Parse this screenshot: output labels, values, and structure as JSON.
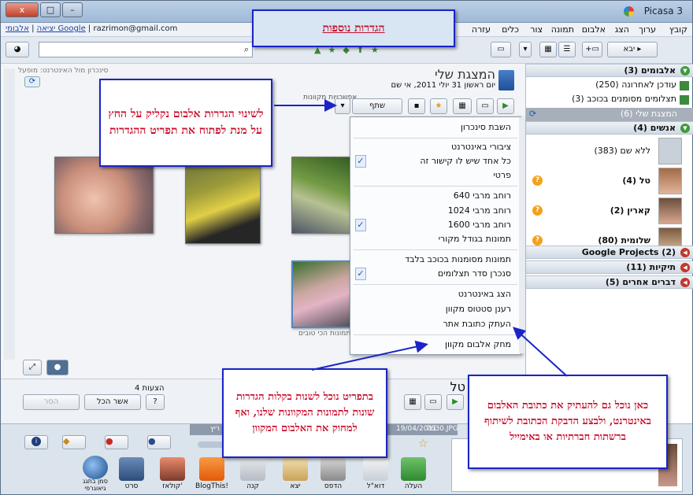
{
  "window": {
    "title": "Picasa 3"
  },
  "titlebar_buttons": {
    "close": "x",
    "max": "□",
    "min": "–"
  },
  "menu": [
    "קובץ",
    "ערוך",
    "הצג",
    "אלבום",
    "תמונה",
    "צור",
    "כלים",
    "עזרה"
  ],
  "account": {
    "signout": "יציאה",
    "google_albums": "אלבומי Google",
    "email": "razrimon@gmail.com"
  },
  "toolbar": {
    "import": "יבא"
  },
  "banner": {
    "title": "הגדרות נוספות"
  },
  "album": {
    "title": "המצגת שלי",
    "date": "יום ראשון 31 יולי 2011, אי שם",
    "share_button": "שתף",
    "sync_label": "סינכרון מול האינטרנט: מופעל",
    "online_options": "אפשרויות מקוונות",
    "best_photos_caption": "התמונות הכי טובים"
  },
  "dropdown": {
    "items": [
      "השבת סינכרון",
      "ציבורי באינטרנט",
      "כל אחד שיש לו קישור זה",
      "פרטי",
      "רוחב מרבי 640",
      "רוחב מרבי 1024",
      "רוחב מרבי 1600",
      "תמונות בגודל מקורי",
      "תמונות מסומנות בכוכב בלבד",
      "סנכרן סדר תצלומים",
      "הצג באינטרנט",
      "רענן סטטוס מקוון",
      "העתק כתובת אתר",
      "מחק אלבום מקוון"
    ],
    "checked": [
      "כל אחד שיש לו קישור זה",
      "רוחב מרבי 1600",
      "סנכרן סדר תצלומים"
    ]
  },
  "callouts": {
    "album_settings": "לשינוי הגדרות אלבום נקליק על החץ על מנת לפתוח את תפריט ההגדרות",
    "menu_settings": "בתפריט נוכל לשנות בקלות הגדרות שונות לתמונות המקוונות שלנו, ואף למחוק את האלבום המקוון",
    "copy_url": "כאן נוכל גם להעתיק את כתובת האלבום באינטרנט, ולבצע הדבקת הכתובת לשיתוף ברשתות חברתיות או באימייל"
  },
  "sidebar": {
    "albums_header": "אלבומים (3)",
    "albums": [
      "עודכן לאחרונה (250)",
      "תצלומים מסומנים בכוכב (3)",
      "המצגת שלי (6)"
    ],
    "people_header": "אנשים (4)",
    "people": [
      {
        "name": "ללא שם (383)"
      },
      {
        "name": "טל (4)"
      },
      {
        "name": "קארין (2)"
      },
      {
        "name": "שלומית (80)"
      }
    ],
    "google_projects": "Google Projects (2)",
    "folders": "תיקיות (11)",
    "other": "דברים אחרים (5)"
  },
  "people_panel": {
    "person_name": "טל",
    "suggestions": "4 הצעות",
    "approve_all": "אשר הכל",
    "remove": "הסר"
  },
  "status_strip": {
    "file": "7630.JPG",
    "date": "19/04/2011",
    "extra": "ריץ"
  },
  "bottom_tools": [
    {
      "label": "העלה"
    },
    {
      "label": "דוא\"ל"
    },
    {
      "label": "הדפס"
    },
    {
      "label": "יצא"
    },
    {
      "label": "קנה"
    },
    {
      "label": "BlogThis!"
    },
    {
      "label": "קולאז'"
    },
    {
      "label": "סרט"
    },
    {
      "label": "סמן בתגג גיאוגרפי"
    }
  ],
  "colors": {
    "accent_red": "#c8102e",
    "callout_border": "#1a24c8",
    "menu_check": "#1f57b5"
  }
}
